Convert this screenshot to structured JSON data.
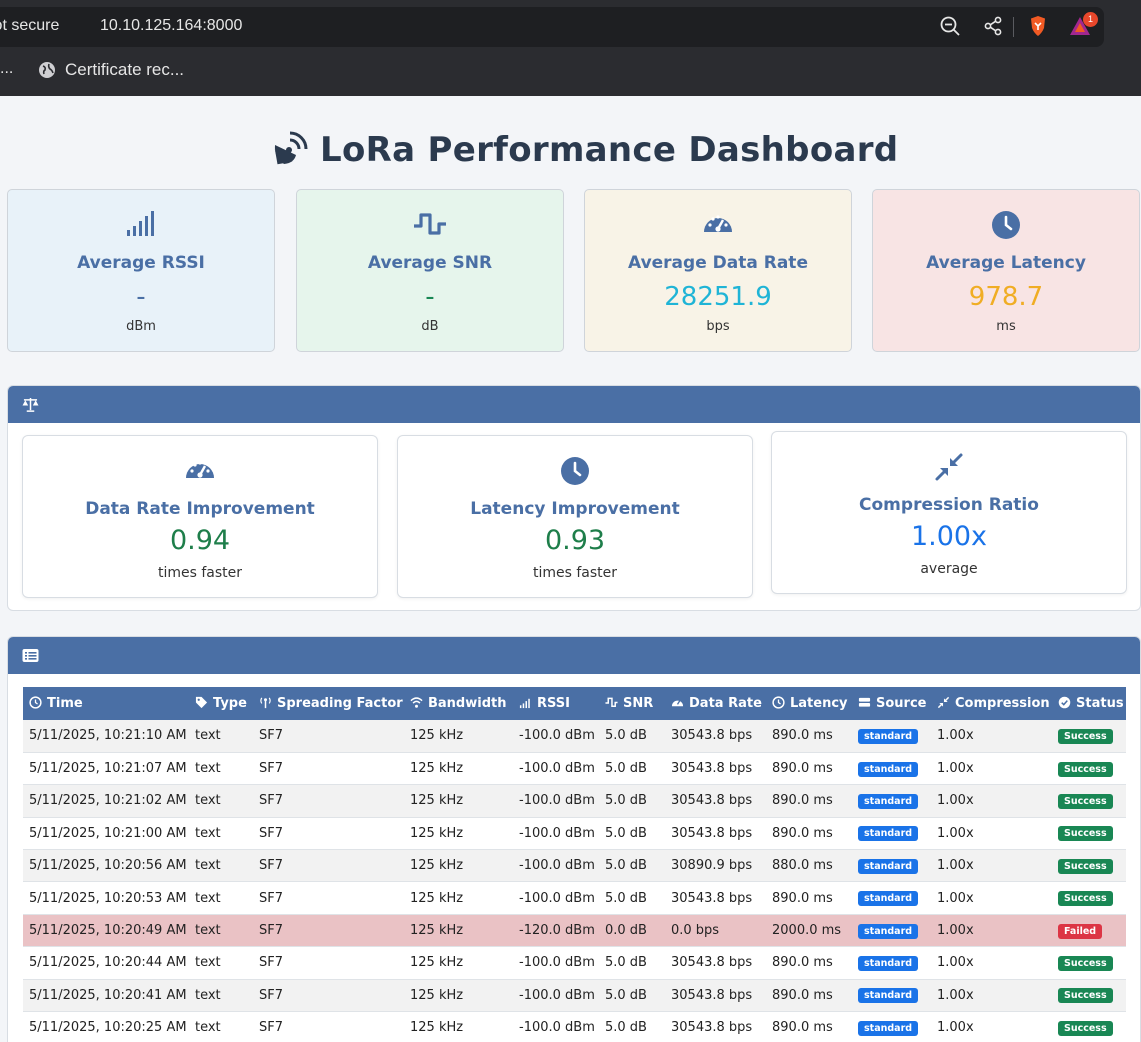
{
  "browser": {
    "security_text": "Not secure",
    "url": "10.10.125.164:8000",
    "notification_count": "1",
    "bookmark_overflow": "...",
    "bookmark_label": "Certificate rec..."
  },
  "page": {
    "title": "LoRa Performance Dashboard"
  },
  "stats": [
    {
      "label": "Average RSSI",
      "value": "-",
      "unit": "dBm",
      "icon": "signal-bars-icon",
      "bg": "#e8f2f9",
      "value_color": "#4a6fa5"
    },
    {
      "label": "Average SNR",
      "value": "-",
      "unit": "dB",
      "icon": "wave-icon",
      "bg": "#e6f5ec",
      "value_color": "#198754"
    },
    {
      "label": "Average Data Rate",
      "value": "28251.9",
      "unit": "bps",
      "icon": "gauge-icon",
      "bg": "#f8f3e7",
      "value_color": "#1fb4d6"
    },
    {
      "label": "Average Latency",
      "value": "978.7",
      "unit": "ms",
      "icon": "clock-icon",
      "bg": "#f8e4e4",
      "value_color": "#f0ad24"
    }
  ],
  "comparison": {
    "header_icon": "balance-scale-icon",
    "cards": [
      {
        "label": "Data Rate Improvement",
        "value": "0.94",
        "unit": "times faster",
        "icon": "gauge-icon",
        "value_color": "#1e7e4a"
      },
      {
        "label": "Latency Improvement",
        "value": "0.93",
        "unit": "times faster",
        "icon": "clock-icon",
        "value_color": "#1e7e4a"
      },
      {
        "label": "Compression Ratio",
        "value": "1.00x",
        "unit": "average",
        "icon": "compress-arrows-icon",
        "value_color": "#1a73e8"
      }
    ]
  },
  "table": {
    "header_icon": "list-icon",
    "columns": [
      {
        "label": "Time",
        "icon": "clock-icon"
      },
      {
        "label": "Type",
        "icon": "tag-icon"
      },
      {
        "label": "Spreading Factor",
        "icon": "antenna-icon"
      },
      {
        "label": "Bandwidth",
        "icon": "wifi-icon"
      },
      {
        "label": "RSSI",
        "icon": "signal-bars-icon"
      },
      {
        "label": "SNR",
        "icon": "wave-icon"
      },
      {
        "label": "Data Rate",
        "icon": "gauge-icon"
      },
      {
        "label": "Latency",
        "icon": "clock-icon"
      },
      {
        "label": "Source",
        "icon": "database-icon"
      },
      {
        "label": "Compression",
        "icon": "compress-arrows-icon"
      },
      {
        "label": "Status",
        "icon": "check-circle-icon"
      }
    ],
    "rows": [
      {
        "time": "5/11/2025, 10:21:10 AM",
        "type": "text",
        "sf": "SF7",
        "bw": "125 kHz",
        "rssi": "-100.0 dBm",
        "snr": "5.0 dB",
        "rate": "30543.8 bps",
        "latency": "890.0 ms",
        "source": "standard",
        "compression": "1.00x",
        "status": "Success"
      },
      {
        "time": "5/11/2025, 10:21:07 AM",
        "type": "text",
        "sf": "SF7",
        "bw": "125 kHz",
        "rssi": "-100.0 dBm",
        "snr": "5.0 dB",
        "rate": "30543.8 bps",
        "latency": "890.0 ms",
        "source": "standard",
        "compression": "1.00x",
        "status": "Success"
      },
      {
        "time": "5/11/2025, 10:21:02 AM",
        "type": "text",
        "sf": "SF7",
        "bw": "125 kHz",
        "rssi": "-100.0 dBm",
        "snr": "5.0 dB",
        "rate": "30543.8 bps",
        "latency": "890.0 ms",
        "source": "standard",
        "compression": "1.00x",
        "status": "Success"
      },
      {
        "time": "5/11/2025, 10:21:00 AM",
        "type": "text",
        "sf": "SF7",
        "bw": "125 kHz",
        "rssi": "-100.0 dBm",
        "snr": "5.0 dB",
        "rate": "30543.8 bps",
        "latency": "890.0 ms",
        "source": "standard",
        "compression": "1.00x",
        "status": "Success"
      },
      {
        "time": "5/11/2025, 10:20:56 AM",
        "type": "text",
        "sf": "SF7",
        "bw": "125 kHz",
        "rssi": "-100.0 dBm",
        "snr": "5.0 dB",
        "rate": "30890.9 bps",
        "latency": "880.0 ms",
        "source": "standard",
        "compression": "1.00x",
        "status": "Success"
      },
      {
        "time": "5/11/2025, 10:20:53 AM",
        "type": "text",
        "sf": "SF7",
        "bw": "125 kHz",
        "rssi": "-100.0 dBm",
        "snr": "5.0 dB",
        "rate": "30543.8 bps",
        "latency": "890.0 ms",
        "source": "standard",
        "compression": "1.00x",
        "status": "Success"
      },
      {
        "time": "5/11/2025, 10:20:49 AM",
        "type": "text",
        "sf": "SF7",
        "bw": "125 kHz",
        "rssi": "-120.0 dBm",
        "snr": "0.0 dB",
        "rate": "0.0 bps",
        "latency": "2000.0 ms",
        "source": "standard",
        "compression": "1.00x",
        "status": "Failed"
      },
      {
        "time": "5/11/2025, 10:20:44 AM",
        "type": "text",
        "sf": "SF7",
        "bw": "125 kHz",
        "rssi": "-100.0 dBm",
        "snr": "5.0 dB",
        "rate": "30543.8 bps",
        "latency": "890.0 ms",
        "source": "standard",
        "compression": "1.00x",
        "status": "Success"
      },
      {
        "time": "5/11/2025, 10:20:41 AM",
        "type": "text",
        "sf": "SF7",
        "bw": "125 kHz",
        "rssi": "-100.0 dBm",
        "snr": "5.0 dB",
        "rate": "30543.8 bps",
        "latency": "890.0 ms",
        "source": "standard",
        "compression": "1.00x",
        "status": "Success"
      },
      {
        "time": "5/11/2025, 10:20:25 AM",
        "type": "text",
        "sf": "SF7",
        "bw": "125 kHz",
        "rssi": "-100.0 dBm",
        "snr": "5.0 dB",
        "rate": "30543.8 bps",
        "latency": "890.0 ms",
        "source": "standard",
        "compression": "1.00x",
        "status": "Success"
      }
    ]
  }
}
